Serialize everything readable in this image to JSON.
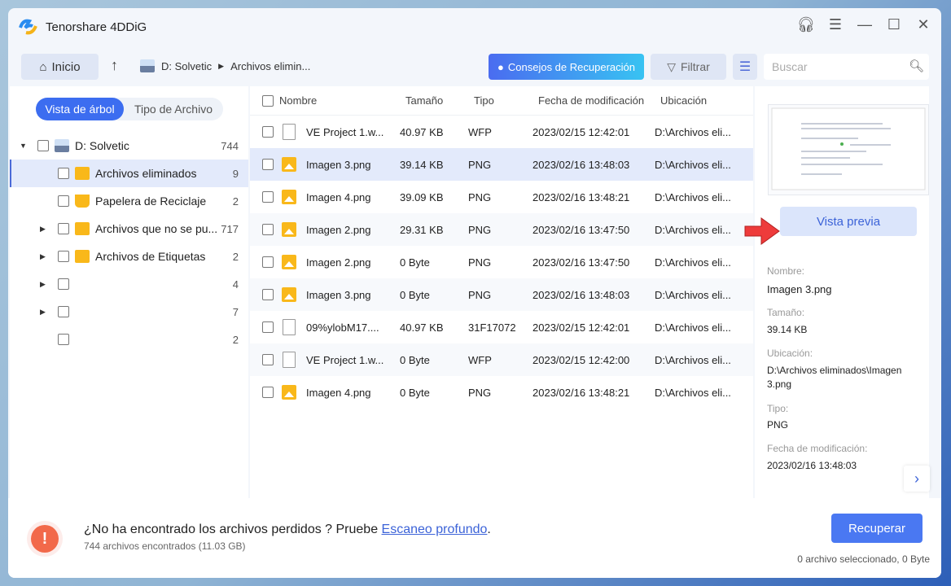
{
  "app": {
    "title": "Tenorshare 4DDiG"
  },
  "window_controls": [
    "headset-icon",
    "menu-icon",
    "minimize-icon",
    "maximize-icon",
    "close-icon"
  ],
  "toolbar": {
    "home": "Inicio",
    "breadcrumb": [
      "D: Solvetic",
      "Archivos elimin..."
    ],
    "tips": "Consejos de Recuperación",
    "filter": "Filtrar",
    "search_placeholder": "Buscar"
  },
  "sidebar": {
    "tabs": [
      "Vista de árbol",
      "Tipo de Archivo"
    ],
    "active_tab": 0,
    "items": [
      {
        "label": "D: Solvetic",
        "count": "744"
      },
      {
        "label": "Archivos eliminados",
        "count": "9"
      },
      {
        "label": "Papelera de Reciclaje",
        "count": "2"
      },
      {
        "label": "Archivos que no se pu...",
        "count": "717"
      },
      {
        "label": "Archivos de Etiquetas",
        "count": "2"
      },
      {
        "label": "",
        "count": "4"
      },
      {
        "label": "",
        "count": "7"
      },
      {
        "label": "",
        "count": "2"
      }
    ]
  },
  "table": {
    "columns": [
      "Nombre",
      "Tamaño",
      "Tipo",
      "Fecha de modificación",
      "Ubicación"
    ],
    "rows": [
      {
        "name": "VE Project 1.w...",
        "size": "40.97 KB",
        "type": "WFP",
        "date": "2023/02/15 12:42:01",
        "loc": "D:\\Archivos eli..."
      },
      {
        "name": "Imagen 3.png",
        "size": "39.14 KB",
        "type": "PNG",
        "date": "2023/02/16 13:48:03",
        "loc": "D:\\Archivos eli..."
      },
      {
        "name": "Imagen 4.png",
        "size": "39.09 KB",
        "type": "PNG",
        "date": "2023/02/16 13:48:21",
        "loc": "D:\\Archivos eli..."
      },
      {
        "name": "Imagen 2.png",
        "size": "29.31 KB",
        "type": "PNG",
        "date": "2023/02/16 13:47:50",
        "loc": "D:\\Archivos eli..."
      },
      {
        "name": "Imagen 2.png",
        "size": "0 Byte",
        "type": "PNG",
        "date": "2023/02/16 13:47:50",
        "loc": "D:\\Archivos eli..."
      },
      {
        "name": "Imagen 3.png",
        "size": "0 Byte",
        "type": "PNG",
        "date": "2023/02/16 13:48:03",
        "loc": "D:\\Archivos eli..."
      },
      {
        "name": "09%ylobM17....",
        "size": "40.97 KB",
        "type": "31F17072",
        "date": "2023/02/15 12:42:01",
        "loc": "D:\\Archivos eli..."
      },
      {
        "name": "VE Project 1.w...",
        "size": "0 Byte",
        "type": "WFP",
        "date": "2023/02/15 12:42:00",
        "loc": "D:\\Archivos eli..."
      },
      {
        "name": "Imagen 4.png",
        "size": "0 Byte",
        "type": "PNG",
        "date": "2023/02/16 13:48:21",
        "loc": "D:\\Archivos eli..."
      }
    ]
  },
  "details": {
    "preview_button": "Vista previa",
    "name_label": "Nombre:",
    "name": "Imagen 3.png",
    "size_label": "Tamaño:",
    "size": "39.14 KB",
    "loc_label": "Ubicación:",
    "loc": "D:\\Archivos eliminados\\Imagen 3.png",
    "type_label": "Tipo:",
    "type": "PNG",
    "date_label": "Fecha de modificación:",
    "date": "2023/02/16 13:48:03"
  },
  "footer": {
    "message": "¿No ha encontrado los archivos perdidos ? Pruebe ",
    "link": "Escaneo profundo",
    "period": ".",
    "found": "744 archivos encontrados (11.03 GB)",
    "recover": "Recuperar",
    "selected": "0 archivo seleccionado, 0 Byte"
  },
  "colors": {
    "accent": "#3c6df0",
    "selected_row": "#e3eafb",
    "warning": "#f2694a"
  }
}
